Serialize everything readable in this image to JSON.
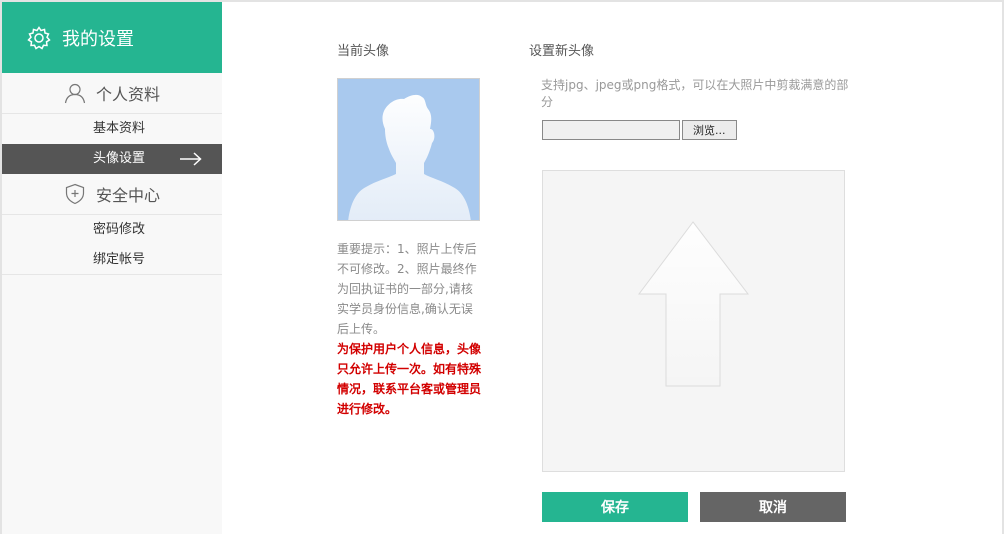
{
  "sidebar": {
    "title": "我的设置",
    "groups": [
      {
        "label": "个人资料",
        "icon": "user-icon",
        "items": [
          {
            "label": "基本资料"
          },
          {
            "label": "头像设置",
            "active": true
          }
        ]
      },
      {
        "label": "安全中心",
        "icon": "shield-icon",
        "items": [
          {
            "label": "密码修改"
          },
          {
            "label": "绑定帐号"
          }
        ]
      }
    ]
  },
  "current": {
    "title": "当前头像",
    "notice": "重要提示：1、照片上传后不可修改。2、照片最终作为回执证书的一部分,请核实学员身份信息,确认无误后上传。",
    "notice_red": "为保护用户个人信息，头像只允许上传一次。如有特殊情况，联系平台客或管理员进行修改。"
  },
  "new_avatar": {
    "title": "设置新头像",
    "hint": "支持jpg、jpeg或png格式，可以在大照片中剪裁满意的部分",
    "file_value": "",
    "browse_label": "浏览..."
  },
  "actions": {
    "save_label": "保存",
    "cancel_label": "取消"
  },
  "colors": {
    "accent": "#25b591",
    "active_nav": "#555555",
    "cancel": "#656565",
    "warning": "#d20000"
  }
}
